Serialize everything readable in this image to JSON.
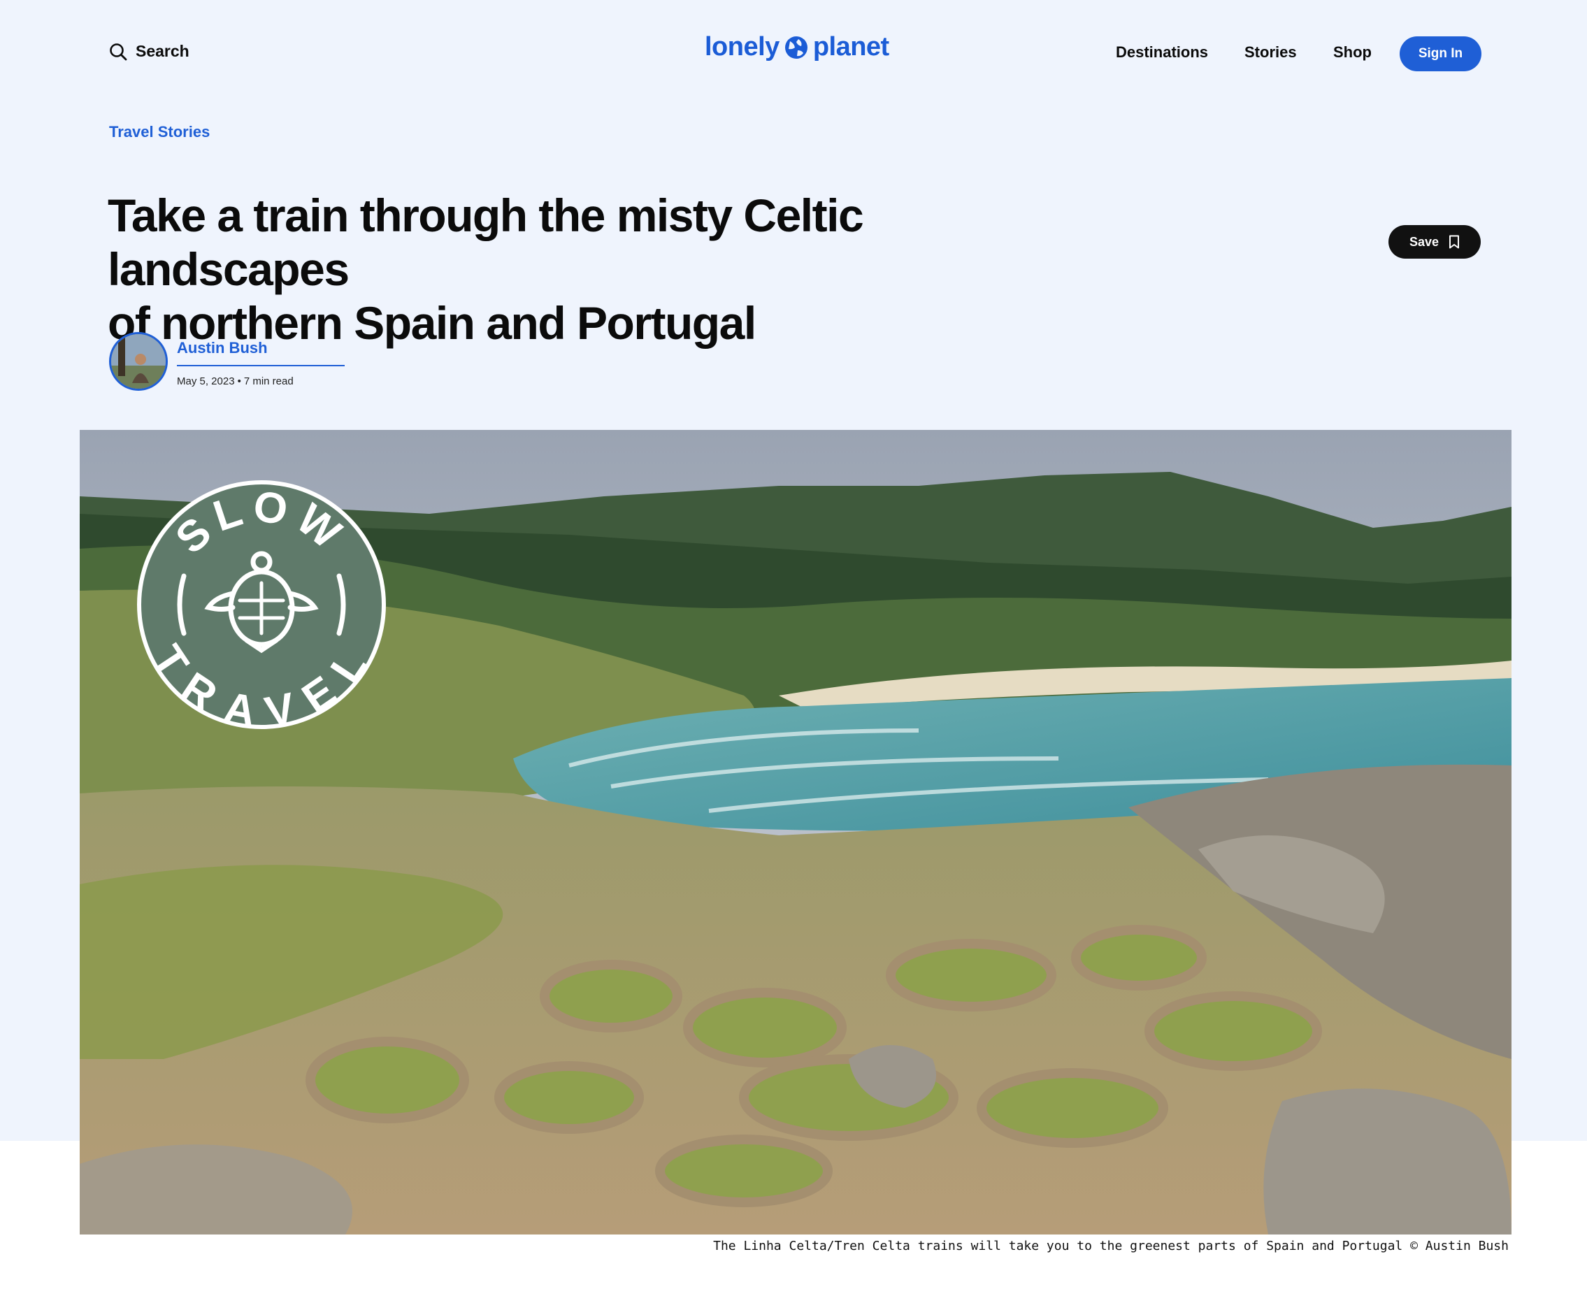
{
  "header": {
    "search_label": "Search",
    "logo_left": "lonely",
    "logo_right": "planet",
    "nav": [
      {
        "label": "Destinations"
      },
      {
        "label": "Stories"
      },
      {
        "label": "Shop"
      }
    ],
    "signin_label": "Sign In"
  },
  "article": {
    "category": "Travel Stories",
    "title_line1": "Take a train through the misty Celtic landscapes",
    "title_line2": "of northern Spain and Portugal",
    "save_label": "Save",
    "author": "Austin Bush",
    "date": "May 5, 2023",
    "separator": "•",
    "read_time": "7 min read",
    "badge_top": "SLOW",
    "badge_bottom": "TRAVEL",
    "caption": "The Linha Celta/Tren Celta trains will take you to the greenest parts of Spain and Portugal © Austin Bush"
  },
  "colors": {
    "accent": "#1f5fd6",
    "hero_background": "#eff4fd",
    "save_button": "#111111",
    "badge": "#5f7a6a"
  },
  "icons": [
    "search-icon",
    "globe-icon",
    "bookmark-icon",
    "turtle-icon"
  ]
}
